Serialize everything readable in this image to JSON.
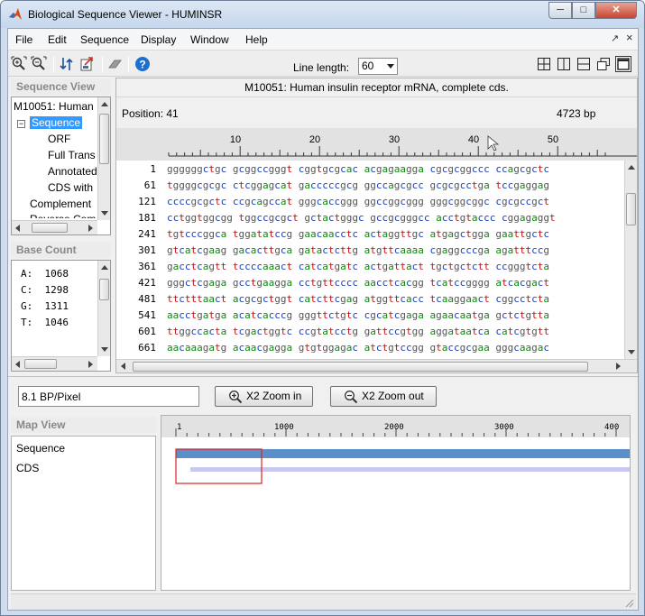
{
  "window": {
    "title": "Biological Sequence Viewer - HUMINSR",
    "minimize": "─",
    "maximize": "□",
    "close": "✕"
  },
  "menubar": {
    "items": [
      "File",
      "Edit",
      "Sequence",
      "Display",
      "Window",
      "Help"
    ],
    "undock": "↗",
    "close": "×"
  },
  "toolbar": {
    "line_length_label": "Line length:",
    "line_length_value": "60"
  },
  "sequence_view": {
    "header": "Sequence View",
    "tree": {
      "root": "M10051: Human",
      "sequence": "Sequence",
      "orf": "ORF",
      "full_trans": "Full Trans",
      "annotated": "Annotated",
      "cds": "CDS with",
      "complement": "Complement",
      "reverse": "Reverse Com"
    }
  },
  "base_count": {
    "header": "Base Count",
    "rows": [
      {
        "base": "A:",
        "count": "1068"
      },
      {
        "base": "C:",
        "count": "1298"
      },
      {
        "base": "G:",
        "count": "1311"
      },
      {
        "base": "T:",
        "count": "1046"
      }
    ]
  },
  "main": {
    "title": "M10051: Human insulin receptor mRNA, complete cds.",
    "position": "Position: 41",
    "length": "4723 bp",
    "ruler_labels": [
      "10",
      "20",
      "30",
      "40",
      "50"
    ],
    "rows": [
      {
        "n": "1",
        "s": "ggggggctgc gcggccgggt cggtgcgcac acgagaagga cgcgcggccc ccagcgctc"
      },
      {
        "n": "61",
        "s": "tggggcgcgc ctcggagcat gacccccgcg ggccagcgcc gcgcgcctga tccgaggag"
      },
      {
        "n": "121",
        "s": "ccccgcgctc ccgcagccat gggcaccggg ggccggcggg gggcggcggc cgcgccgct"
      },
      {
        "n": "181",
        "s": "cctggtggcgg tggccgcgct gctactgggc gccgcgggcc acctgtaccc cggagaggt"
      },
      {
        "n": "241",
        "s": "tgtcccggca tggatatccg gaacaacctc actaggttgc atgagctgga gaattgctc"
      },
      {
        "n": "301",
        "s": "gtcatcgaag gacacttgca gatactcttg atgttcaaaa cgaggcccga agatttccg"
      },
      {
        "n": "361",
        "s": "gacctcagtt tccccaaact catcatgatc actgattact tgctgctctt ccgggtcta"
      },
      {
        "n": "421",
        "s": "gggctcgaga gcctgaagga cctgttcccc aacctcacgg tcatccgggg atcacgact"
      },
      {
        "n": "481",
        "s": "ttctttaact acgcgctggt catcttcgag atggttcacc tcaaggaact cggcctcta"
      },
      {
        "n": "541",
        "s": "aacctgatga acatcacccg gggttctgtc cgcatcgaga agaacaatga gctctgtta"
      },
      {
        "n": "601",
        "s": "ttggccacta tcgactggtc ccgtatcctg gattccgtgg aggataatca catcgtgtt"
      },
      {
        "n": "661",
        "s": "aacaaagatg acaacgagga gtgtggagac atctgtccgg gtaccgcgaa gggcaagac"
      },
      {
        "n": "721",
        "s": "aactgccccg ccaccgtcat caacgggcag tttgtcgaac gatgttggac tcatagtca"
      }
    ]
  },
  "zoom": {
    "bp_per_pixel": "8.1 BP/Pixel",
    "zoom_in": "X2 Zoom in",
    "zoom_out": "X2 Zoom out"
  },
  "map_view": {
    "header": "Map View",
    "tracks": [
      "Sequence",
      "CDS"
    ],
    "ruler_labels": [
      "1",
      "1000",
      "2000",
      "3000",
      "400"
    ],
    "sequence_color": "#5b8fc9",
    "cds_color": "#c8c8f0",
    "window_color": "#dd2222"
  }
}
